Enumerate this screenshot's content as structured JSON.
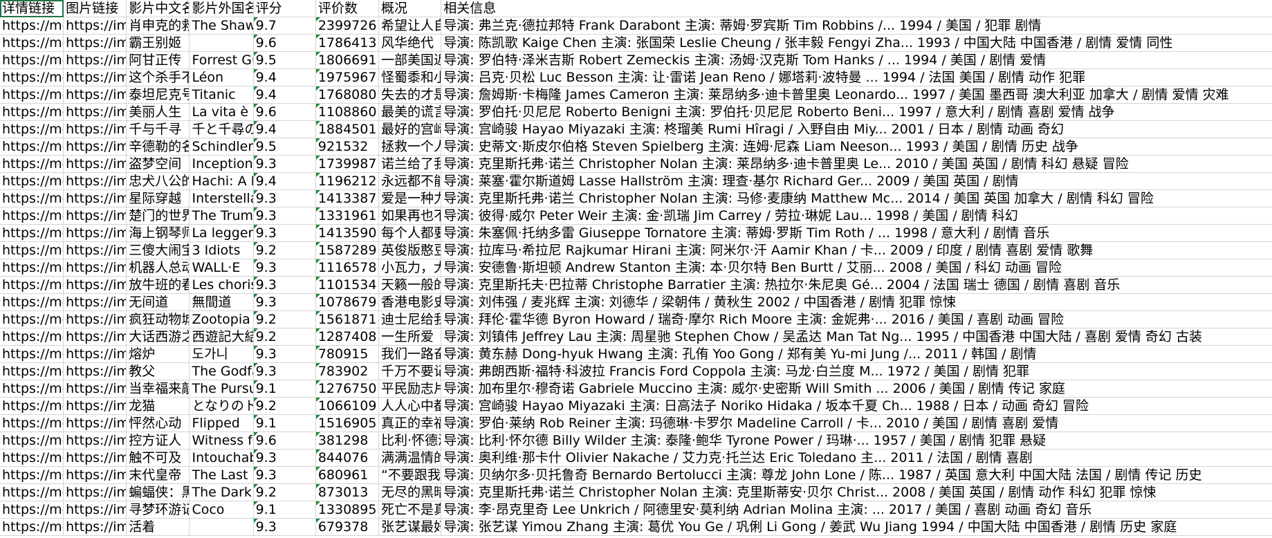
{
  "headers": [
    "详情链接",
    "图片链接",
    "影片中文名",
    "影片外国名",
    "评分",
    "评价数",
    "概况",
    "相关信息"
  ],
  "rows": [
    [
      "https://movie",
      "https://img",
      "肖申克的救赎",
      "The Shawshank Redemption",
      "9.7",
      "2399726",
      "希望让人自由",
      "导演: 弗兰克·德拉邦特 Frank Darabont 主演: 蒂姆·罗宾斯 Tim Robbins /... 1994 / 美国 / 犯罪 剧情"
    ],
    [
      "https://movie",
      "https://img",
      "霸王别姬",
      "",
      "9.6",
      "1786413",
      "风华绝代",
      "导演: 陈凯歌 Kaige Chen 主演: 张国荣 Leslie Cheung / 张丰毅 Fengyi Zha... 1993 / 中国大陆 中国香港 / 剧情 爱情 同性"
    ],
    [
      "https://movie",
      "https://img",
      "阿甘正传",
      "Forrest Gump",
      "9.5",
      "1806691",
      "一部美国近现代史",
      "导演: 罗伯特·泽米吉斯 Robert Zemeckis 主演: 汤姆·汉克斯 Tom Hanks / ... 1994 / 美国 / 剧情 爱情"
    ],
    [
      "https://movie",
      "https://img",
      "这个杀手不太冷",
      "Léon",
      "9.4",
      "1975967",
      "怪蜀黍和小萝莉",
      "导演: 吕克·贝松 Luc Besson 主演: 让·雷诺 Jean Reno / 娜塔莉·波特曼 ... 1994 / 法国 美国 / 剧情 动作 犯罪"
    ],
    [
      "https://movie",
      "https://img",
      "泰坦尼克号",
      "Titanic",
      "9.4",
      "1768080",
      "失去的才是永恒的",
      "导演: 詹姆斯·卡梅隆 James Cameron 主演: 莱昂纳多·迪卡普里奥 Leonardo... 1997 / 美国 墨西哥 澳大利亚 加拿大 / 剧情 爱情 灾难"
    ],
    [
      "https://movie",
      "https://img",
      "美丽人生",
      "La vita è bella",
      "9.6",
      "1108860",
      "最美的谎言",
      "导演: 罗伯托·贝尼尼 Roberto Benigni 主演: 罗伯托·贝尼尼 Roberto Beni... 1997 / 意大利 / 剧情 喜剧 爱情 战争"
    ],
    [
      "https://movie",
      "https://img",
      "千与千寻",
      "千と千尋の神隠し",
      "9.4",
      "1884501",
      "最好的宫崎骏",
      "导演: 宫崎骏 Hayao Miyazaki 主演: 柊瑠美 Rumi Hîragi / 入野自由 Miy... 2001 / 日本 / 剧情 动画 奇幻"
    ],
    [
      "https://movie",
      "https://img",
      "辛德勒的名单",
      "Schindler's List",
      "9.5",
      "921532",
      "拯救一个人",
      "导演: 史蒂文·斯皮尔伯格 Steven Spielberg 主演: 连姆·尼森 Liam Neeson... 1993 / 美国 / 剧情 历史 战争"
    ],
    [
      "https://movie",
      "https://img",
      "盗梦空间",
      "Inception",
      "9.3",
      "1739987",
      "诺兰给了我们",
      "导演: 克里斯托弗·诺兰 Christopher Nolan 主演: 莱昂纳多·迪卡普里奥 Le... 2010 / 美国 英国 / 剧情 科幻 悬疑 冒险"
    ],
    [
      "https://movie",
      "https://img",
      "忠犬八公的故事",
      "Hachi: A Dog's Tale",
      "9.4",
      "1196212",
      "永远都不能忘记",
      "导演: 莱塞·霍尔斯道姆 Lasse Hallström 主演: 理查·基尔 Richard Ger... 2009 / 美国 英国 / 剧情"
    ],
    [
      "https://movie",
      "https://img",
      "星际穿越",
      "Interstellar",
      "9.3",
      "1413387",
      "爱是一种力量",
      "导演: 克里斯托弗·诺兰 Christopher Nolan 主演: 马修·麦康纳 Matthew Mc... 2014 / 美国 英国 加拿大 / 剧情 科幻 冒险"
    ],
    [
      "https://movie",
      "https://img",
      "楚门的世界",
      "The Truman Show",
      "9.3",
      "1331961",
      "如果再也不能",
      "导演: 彼得·威尔 Peter Weir 主演: 金·凯瑞 Jim Carrey / 劳拉·琳妮 Lau... 1998 / 美国 / 剧情 科幻"
    ],
    [
      "https://movie",
      "https://img",
      "海上钢琴师",
      "La leggenda",
      "9.3",
      "1413590",
      "每个人都要走",
      "导演: 朱塞佩·托纳多雷 Giuseppe Tornatore 主演: 蒂姆·罗斯 Tim Roth / ... 1998 / 意大利 / 剧情 音乐"
    ],
    [
      "https://movie",
      "https://img",
      "三傻大闹宝莱坞",
      "3 Idiots",
      "9.2",
      "1587289",
      "英俊版憨豆",
      "导演: 拉库马·希拉尼 Rajkumar Hirani 主演: 阿米尔·汗 Aamir Khan / 卡... 2009 / 印度 / 剧情 喜剧 爱情 歌舞"
    ],
    [
      "https://movie",
      "https://img",
      "机器人总动员",
      "WALL·E",
      "9.3",
      "1116578",
      "小瓦力，大人生",
      "导演: 安德鲁·斯坦顿 Andrew Stanton 主演: 本·贝尔特 Ben Burtt / 艾丽... 2008 / 美国 / 科幻 动画 冒险"
    ],
    [
      "https://movie",
      "https://img",
      "放牛班的春天",
      "Les choristes",
      "9.3",
      "1101534",
      "天籁一般的童声",
      "导演: 克里斯托夫·巴拉蒂 Christophe Barratier 主演: 热拉尔·朱尼奥 Gé... 2004 / 法国 瑞士 德国 / 剧情 喜剧 音乐"
    ],
    [
      "https://movie",
      "https://img",
      "无间道",
      "無間道",
      "9.3",
      "1078679",
      "香港电影史上",
      "导演: 刘伟强 / 麦兆辉 主演: 刘德华 / 梁朝伟 / 黄秋生 2002 / 中国香港 / 剧情 犯罪 惊悚"
    ],
    [
      "https://movie",
      "https://img",
      "疯狂动物城",
      "Zootopia",
      "9.2",
      "1561871",
      "迪士尼给我们",
      "导演: 拜伦·霍华德 Byron Howard / 瑞奇·摩尔 Rich Moore 主演: 金妮弗·... 2016 / 美国 / 喜剧 动画 冒险"
    ],
    [
      "https://movie",
      "https://img",
      "大话西游之大圣娶亲",
      "西遊記大結局",
      "9.2",
      "1287408",
      "一生所爱",
      "导演: 刘镇伟 Jeffrey Lau 主演: 周星驰 Stephen Chow / 吴孟达 Man Tat Ng... 1995 / 中国香港 中国大陆 / 喜剧 爱情 奇幻 古装"
    ],
    [
      "https://movie",
      "https://img",
      "熔炉",
      "도가니",
      "9.3",
      "780915",
      "我们一路奋战",
      "导演: 黄东赫 Dong-hyuk Hwang 主演: 孔侑 Yoo Gong / 郑有美 Yu-mi Jung /... 2011 / 韩国 / 剧情"
    ],
    [
      "https://movie",
      "https://img",
      "教父",
      "The Godfather",
      "9.3",
      "783902",
      "千万不要记恨",
      "导演: 弗朗西斯·福特·科波拉 Francis Ford Coppola 主演: 马龙·白兰度 M... 1972 / 美国 / 剧情 犯罪"
    ],
    [
      "https://movie",
      "https://img",
      "当幸福来敲门",
      "The Pursuit of Happyness",
      "9.1",
      "1276750",
      "平民励志片",
      "导演: 加布里尔·穆奇诺 Gabriele Muccino 主演: 威尔·史密斯 Will Smith ... 2006 / 美国 / 剧情 传记 家庭"
    ],
    [
      "https://movie",
      "https://img",
      "龙猫",
      "となりのトトロ",
      "9.2",
      "1066109",
      "人人心中都有",
      "导演: 宫崎骏 Hayao Miyazaki 主演: 日高法子 Noriko Hidaka / 坂本千夏 Ch... 1988 / 日本 / 动画 奇幻 冒险"
    ],
    [
      "https://movie",
      "https://img",
      "怦然心动",
      "Flipped",
      "9.1",
      "1516905",
      "真正的幸福是",
      "导演: 罗伯·莱纳 Rob Reiner 主演: 玛德琳·卡罗尔 Madeline Carroll / 卡... 2010 / 美国 / 剧情 喜剧 爱情"
    ],
    [
      "https://movie",
      "https://img",
      "控方证人",
      "Witness for the Prosecution",
      "9.6",
      "381298",
      "比利·怀德满分",
      "导演: 比利·怀尔德 Billy Wilder 主演: 泰隆·鲍华 Tyrone Power / 玛琳·... 1957 / 美国 / 剧情 犯罪 悬疑"
    ],
    [
      "https://movie",
      "https://img",
      "触不可及",
      "Intouchables",
      "9.3",
      "844076",
      "满满温情的",
      "导演: 奥利维·那卡什 Olivier Nakache / 艾力克·托兰达 Eric Toledano 主... 2011 / 法国 / 剧情 喜剧"
    ],
    [
      "https://movie",
      "https://img",
      "末代皇帝",
      "The Last Emperor",
      "9.3",
      "680961",
      "“不要跟我比",
      "导演: 贝纳尔多·贝托鲁奇 Bernardo Bertolucci 主演: 尊龙 John Lone / 陈... 1987 / 英国 意大利 中国大陆 法国 / 剧情 传记 历史"
    ],
    [
      "https://movie",
      "https://img",
      "蝙蝠侠：黑暗骑士",
      "The Dark Knight",
      "9.2",
      "873013",
      "无尽的黑暗",
      "导演: 克里斯托弗·诺兰 Christopher Nolan 主演: 克里斯蒂安·贝尔 Christ... 2008 / 美国 英国 / 剧情 动作 科幻 犯罪 惊悚"
    ],
    [
      "https://movie",
      "https://img",
      "寻梦环游记",
      "Coco",
      "9.1",
      "1330895",
      "死亡不是真的",
      "导演: 李·昂克里奇 Lee Unkrich / 阿德里安·莫利纳 Adrian Molina 主演: ... 2017 / 美国 / 喜剧 动画 奇幻 音乐"
    ],
    [
      "https://movie",
      "https://img",
      "活着",
      "",
      "9.3",
      "679378",
      "张艺谋最好的",
      "导演: 张艺谋 Yimou Zhang 主演: 葛优 You Ge / 巩俐 Li Gong / 姜武 Wu Jiang 1994 / 中国大陆 中国香港 / 剧情 历史 家庭"
    ]
  ]
}
